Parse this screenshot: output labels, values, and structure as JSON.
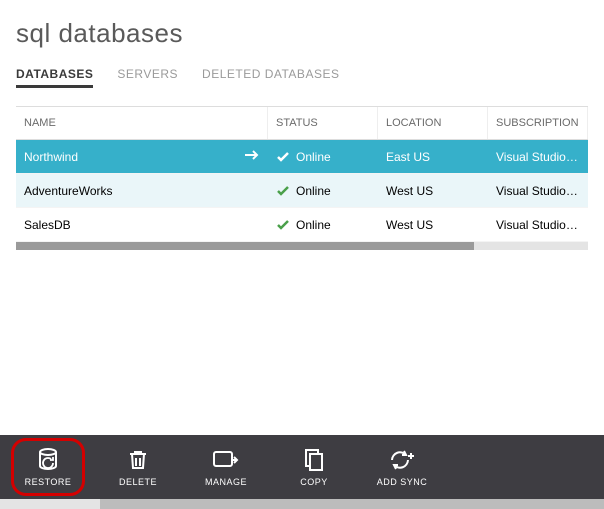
{
  "title": "sql databases",
  "tabs": [
    {
      "label": "DATABASES",
      "active": true
    },
    {
      "label": "SERVERS",
      "active": false
    },
    {
      "label": "DELETED DATABASES",
      "active": false
    }
  ],
  "columns": {
    "name": "NAME",
    "status": "STATUS",
    "location": "LOCATION",
    "subscription": "SUBSCRIPTION"
  },
  "rows": [
    {
      "name": "Northwind",
      "status": "Online",
      "location": "East US",
      "subscription": "Visual Studio Ultim...",
      "selected": true
    },
    {
      "name": "AdventureWorks",
      "status": "Online",
      "location": "West US",
      "subscription": "Visual Studio Ultim...",
      "selected": false
    },
    {
      "name": "SalesDB",
      "status": "Online",
      "location": "West US",
      "subscription": "Visual Studio Ultim...",
      "selected": false
    }
  ],
  "commands": {
    "restore": "RESTORE",
    "delete": "DELETE",
    "manage": "MANAGE",
    "copy": "COPY",
    "addsync": "ADD SYNC"
  }
}
